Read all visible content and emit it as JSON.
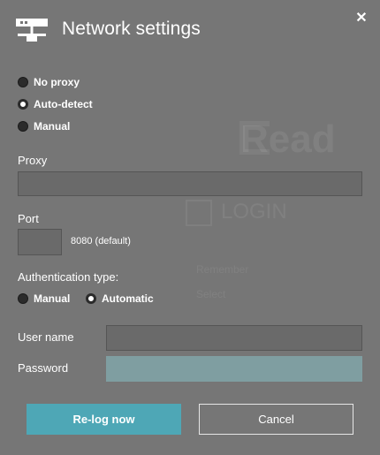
{
  "dialog": {
    "title": "Network settings",
    "close_label": "✕"
  },
  "proxy_mode": {
    "options": [
      {
        "label": "No proxy",
        "checked": false
      },
      {
        "label": "Auto-detect",
        "checked": true
      },
      {
        "label": "Manual",
        "checked": false
      }
    ]
  },
  "proxy": {
    "label": "Proxy",
    "value": "",
    "placeholder": ""
  },
  "port": {
    "label": "Port",
    "value": "",
    "hint": "8080 (default)"
  },
  "authentication": {
    "label": "Authentication type:",
    "options": [
      {
        "label": "Manual",
        "checked": false
      },
      {
        "label": "Automatic",
        "checked": true
      }
    ]
  },
  "username": {
    "label": "User name",
    "value": ""
  },
  "password": {
    "label": "Password",
    "value": ""
  },
  "buttons": {
    "primary": "Re-log now",
    "secondary": "Cancel"
  },
  "background_ghost": {
    "app_title": "Read",
    "login_text": "LOGIN",
    "line1": "Remember",
    "line2": "Select"
  },
  "colors": {
    "overlay_bg": "#767676",
    "accent": "#4ea7b6",
    "field_bg": "#6a6a6a",
    "password_field_bg": "#7f9ea1"
  },
  "icons": {
    "header": "network-icon",
    "close": "close-icon"
  }
}
